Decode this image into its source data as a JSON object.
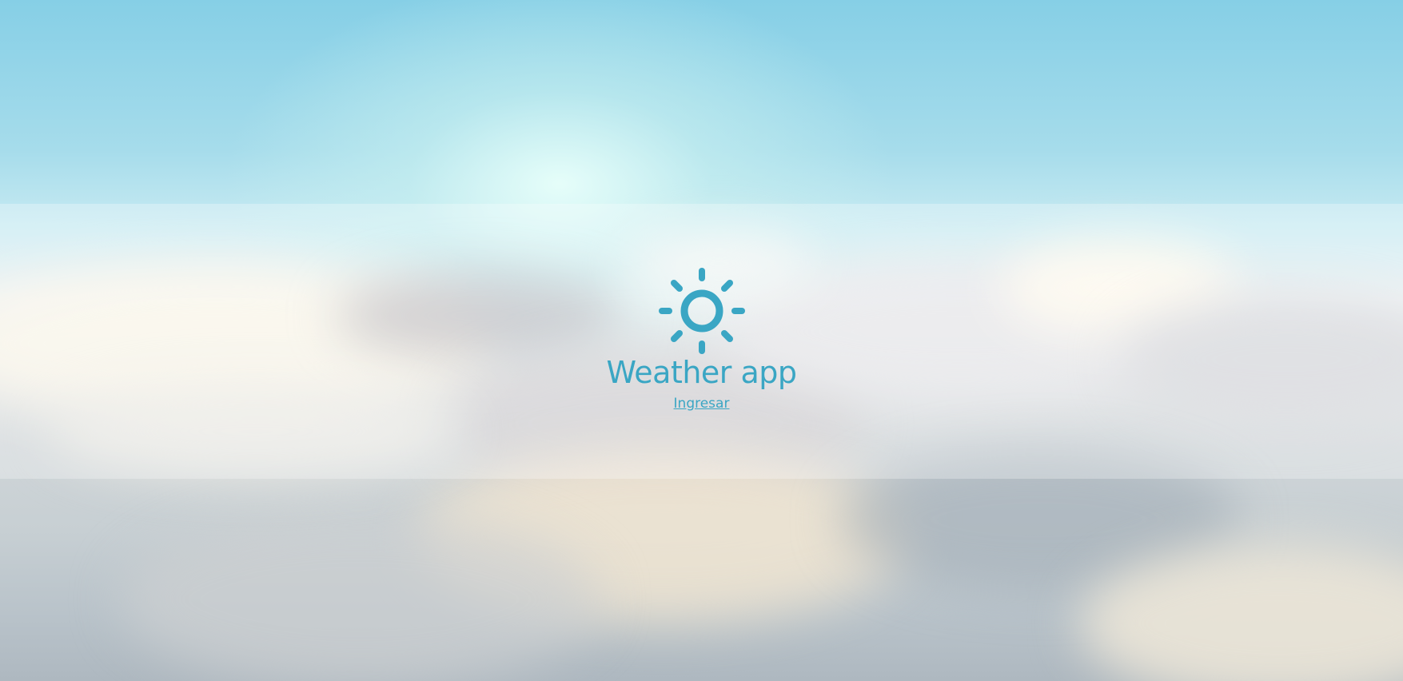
{
  "app": {
    "title": "Weather app",
    "logo_icon": "sun-icon",
    "login_link_label": "Ingresar"
  },
  "colors": {
    "accent": "#3aa6c4",
    "sky_top": "#86cfe6",
    "band_overlay": "rgba(255,255,255,0.28)"
  }
}
